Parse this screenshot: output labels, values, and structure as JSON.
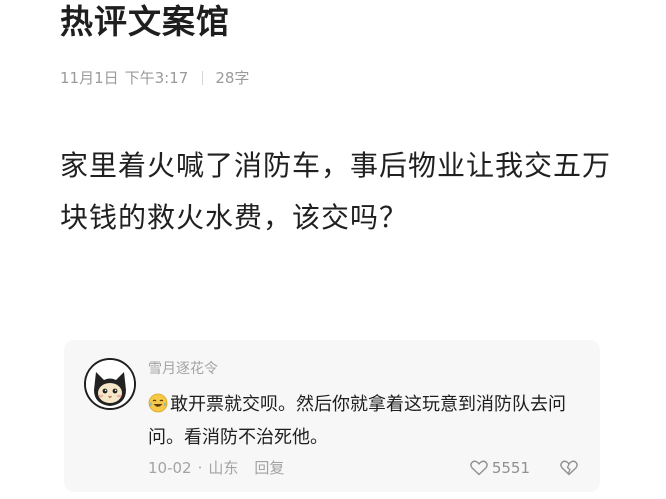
{
  "article": {
    "title": "热评文案馆",
    "date": "11月1日",
    "time": "下午3:17",
    "word_count": "28字",
    "body": "家里着火喊了消防车，事后物业让我交五万块钱的救火水费，该交吗？"
  },
  "comment": {
    "username": "雪月逐花令",
    "avatar_icon": "black-cat-avatar-icon",
    "emoji_icon": "laughing-crying-emoji-icon",
    "text": "敢开票就交呗。然后你就拿着这玩意到消防队去问问。看消防不治死他。",
    "date": "10-02",
    "location": "山东",
    "reply_label": "回复",
    "likes": "5551",
    "like_icon": "heart-icon",
    "dislike_icon": "broken-heart-icon"
  }
}
